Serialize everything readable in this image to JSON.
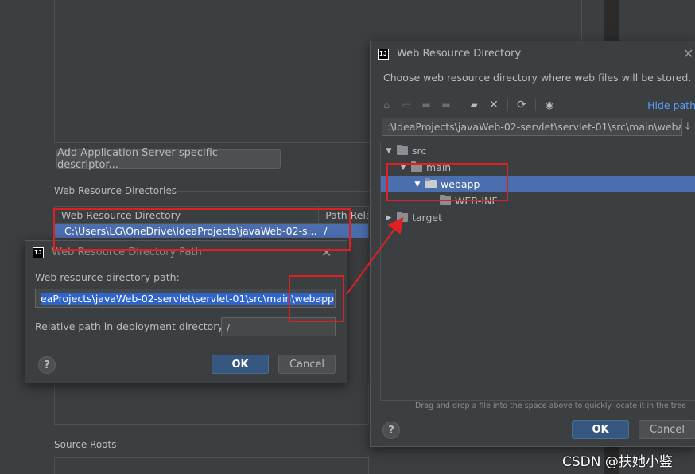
{
  "background": {
    "add_descriptor_button": "Add Application Server specific descriptor...",
    "web_resource_section": "Web Resource Directories",
    "table": {
      "headers": [
        "Web Resource Directory",
        "Path Relat"
      ],
      "rows": [
        {
          "directory": "C:\\Users\\LG\\OneDrive\\IdeaProjects\\javaWeb-02-s...",
          "path": "/"
        }
      ]
    },
    "source_roots_section": "Source Roots"
  },
  "path_dialog": {
    "title": "Web Resource Directory Path",
    "path_label": "Web resource directory path:",
    "path_value": "eaProjects\\javaWeb-02-servlet\\servlet-01\\src\\main\\webapp",
    "relative_label": "Relative path in deployment directory:",
    "relative_value": "/",
    "ok_label": "OK",
    "cancel_label": "Cancel",
    "help_label": "?"
  },
  "chooser_dialog": {
    "title": "Web Resource Directory",
    "description": "Choose web resource directory where web files will be stored.",
    "hide_path_label": "Hide path",
    "path_value": ":\\IdeaProjects\\javaWeb-02-servlet\\servlet-01\\src\\main\\webapp",
    "tree": [
      {
        "label": "src",
        "expanded": true
      },
      {
        "label": "main",
        "expanded": true
      },
      {
        "label": "webapp",
        "expanded": true,
        "selected": true
      },
      {
        "label": "WEB-INF",
        "expanded": false
      },
      {
        "label": "target",
        "expanded": false
      }
    ],
    "drop_hint": "Drag and drop a file into the space above to quickly locate it in the tree",
    "ok_label": "OK",
    "cancel_label": "Cancel",
    "help_label": "?"
  },
  "watermark": "CSDN @扶她小鉴",
  "colors": {
    "selection": "#4b6eaf",
    "annotation": "#e02020",
    "ok_button": "#365880"
  }
}
